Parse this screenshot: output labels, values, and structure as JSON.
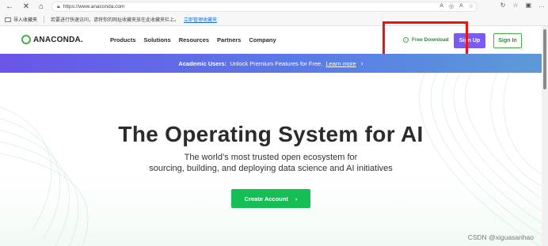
{
  "browser": {
    "address": {
      "url": "https://www.anaconda.com"
    },
    "favorites_bar": {
      "folder_label": "导入收藏夹",
      "message": "若要进行快速访问，请将你的网址收藏夹放在此收藏夹栏上。",
      "link": "立即管理收藏夹"
    }
  },
  "site": {
    "logo_text": "ANACONDA.",
    "nav": [
      "Products",
      "Solutions",
      "Resources",
      "Partners",
      "Company"
    ],
    "free_download": "Free Download",
    "sign_up": "Sign Up",
    "sign_in": "Sign In"
  },
  "banner": {
    "strong": "Academic Users:",
    "text": "Unlock Premium Features for Free.",
    "link": "Learn more"
  },
  "hero": {
    "title": "The Operating System for AI",
    "subtitle_line1": "The world’s most trusted open ecosystem for",
    "subtitle_line2": "sourcing, building, and deploying data science and AI initiatives",
    "cta": "Create Account"
  },
  "watermark": "CSDN @xiguasanhao",
  "colors": {
    "brand_green": "#43b049",
    "cta_green": "#16bf55",
    "purple": "#7b5af3",
    "highlight_red": "#f2120d"
  },
  "icons": {
    "back": "arrow-left-icon",
    "close": "close-icon",
    "home": "home-icon",
    "lock": "lock-icon",
    "download": "download-icon",
    "chevron": "chevron-right-icon"
  }
}
